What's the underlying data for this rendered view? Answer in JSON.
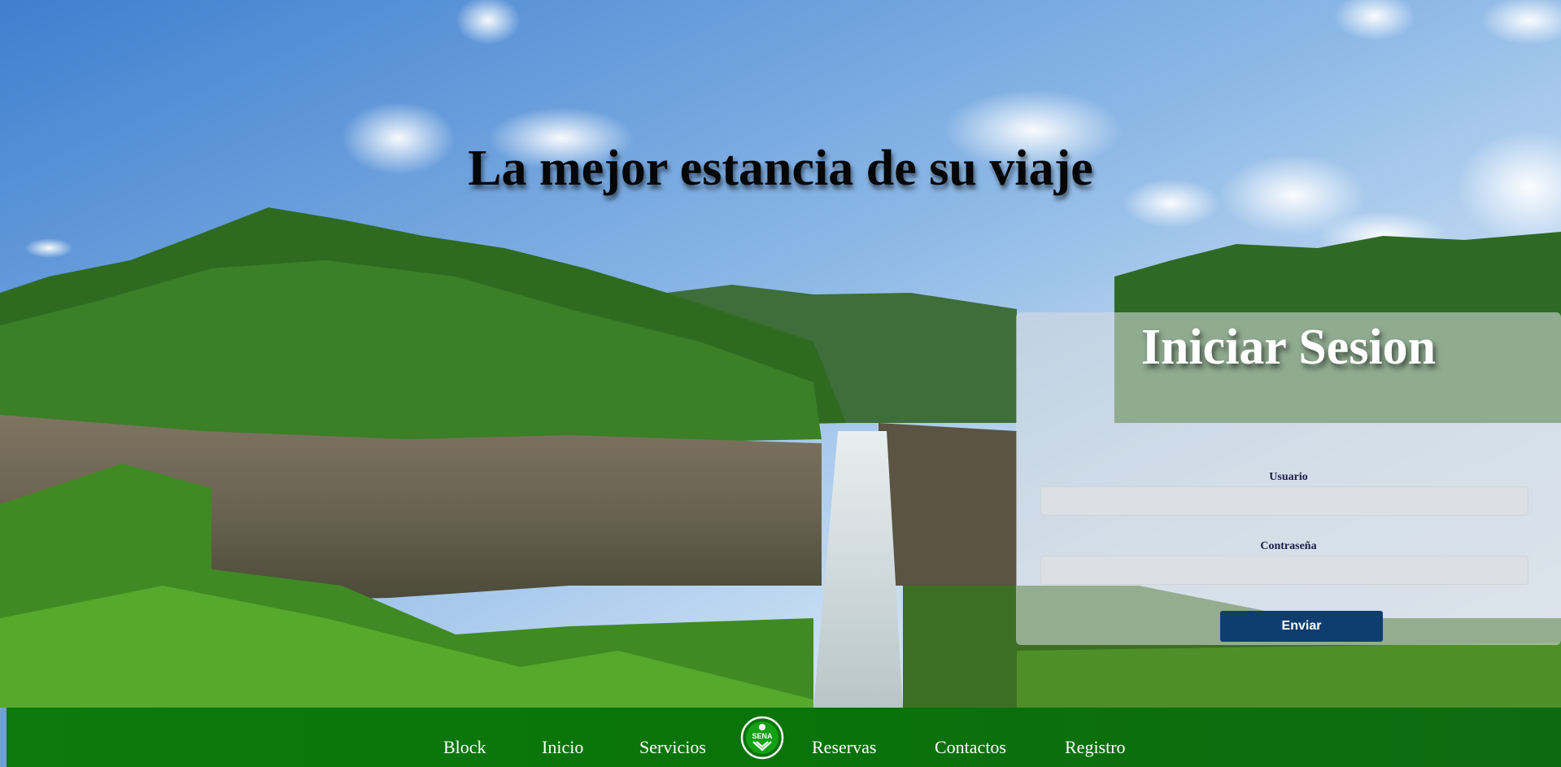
{
  "hero": {
    "headline": "La mejor estancia de su viaje"
  },
  "login": {
    "title": "Iniciar Sesion",
    "username_label": "Usuario",
    "username_value": "",
    "password_label": "Contraseña",
    "password_value": "",
    "submit_label": "Enviar"
  },
  "nav": {
    "items": [
      {
        "label": "Block"
      },
      {
        "label": "Inicio"
      },
      {
        "label": "Servicios"
      },
      {
        "label": "Reservas"
      },
      {
        "label": "Contactos"
      },
      {
        "label": "Registro"
      }
    ],
    "logo_icon": "sena-logo-icon",
    "logo_text": "SENA"
  },
  "colors": {
    "nav_background": "#0a730a",
    "submit_button": "#0e3d6e",
    "login_panel": "rgba(214,218,222,0.58)"
  }
}
